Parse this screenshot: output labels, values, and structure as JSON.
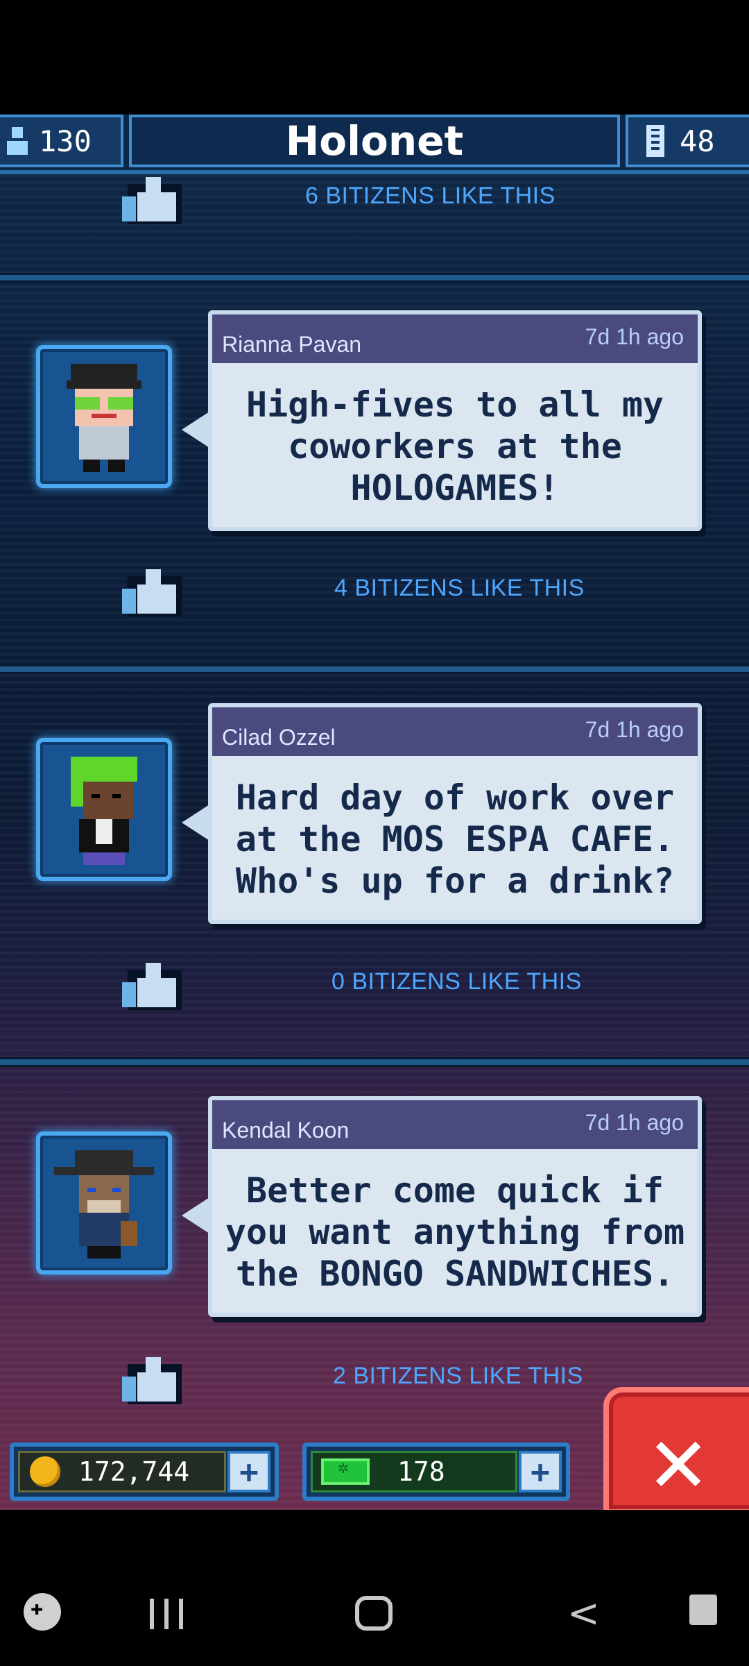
{
  "header": {
    "population": "130",
    "title": "Holonet",
    "floors": "48"
  },
  "posts": [
    {
      "author": "Rianna Pavan",
      "time": "7d 1h ago",
      "message": "High-fives to all my coworkers at the HOLOGAMES!",
      "likes": "4 BITIZENS LIKE THIS"
    },
    {
      "author": "Cilad Ozzel",
      "time": "7d 1h ago",
      "message": "Hard day of work over at the MOS ESPA CAFE. Who's up for a drink?",
      "likes": "0 BITIZENS LIKE THIS"
    },
    {
      "author": "Kendal Koon",
      "time": "7d 1h ago",
      "message": "Better come quick if you want anything from the BONGO SANDWICHES.",
      "likes": "2 BITIZENS LIKE THIS"
    }
  ],
  "previous_post_likes": "6 BITIZENS LIKE THIS",
  "footer": {
    "coins": "172,744",
    "bux": "178",
    "plus_label": "+",
    "close_label": "✕"
  },
  "icons": {
    "population": "person-icon",
    "floors": "elevator-icon",
    "like": "thumbs-up-icon",
    "coins": "coin-icon",
    "bux": "bux-icon"
  }
}
